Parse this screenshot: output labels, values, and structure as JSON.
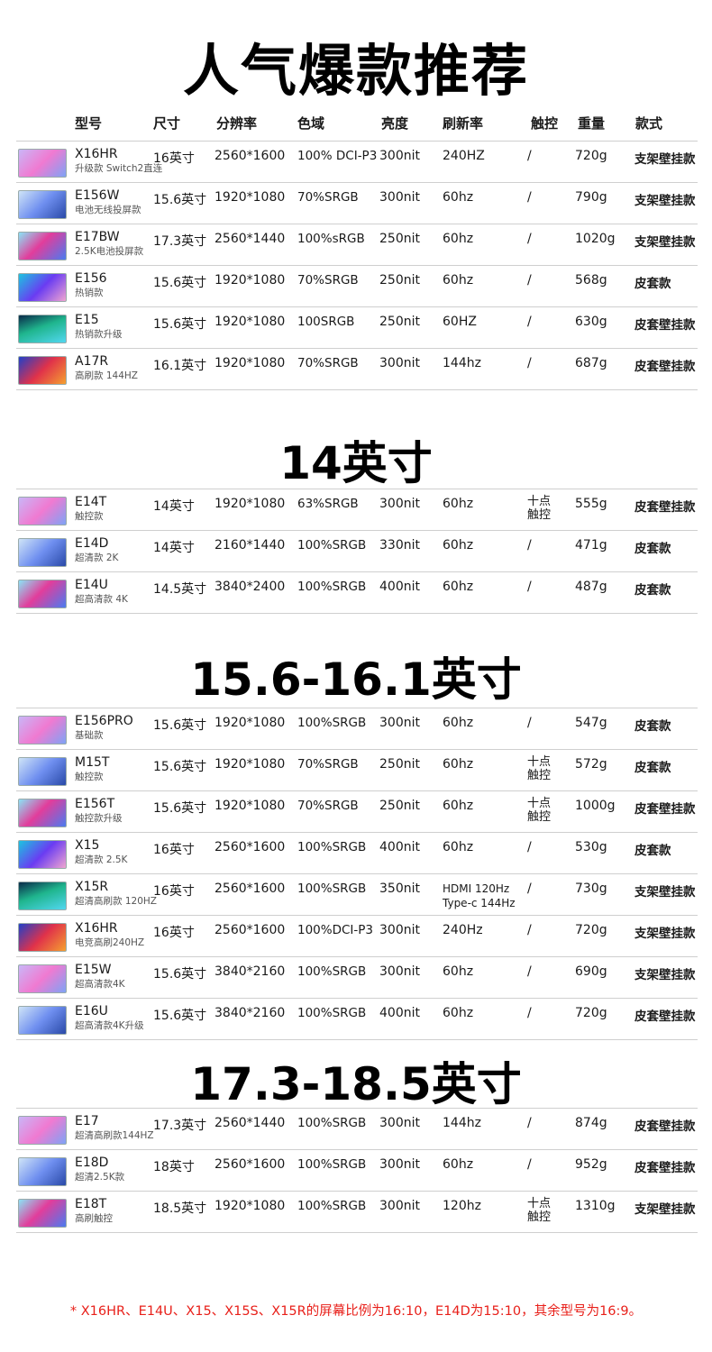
{
  "title_main": "人气爆款推荐",
  "headers": {
    "model": "型号",
    "size": "尺寸",
    "resolution": "分辨率",
    "gamut": "色域",
    "brightness": "亮度",
    "refresh": "刷新率",
    "touch": "触控",
    "weight": "重量",
    "style": "款式"
  },
  "section1": {
    "rows": [
      {
        "model": "X16HR",
        "sub": "升级款 Switch2直连",
        "size": "16英寸",
        "res": "2560*1600",
        "gamut": "100% DCI-P3",
        "bri": "300nit",
        "hz": "240HZ",
        "touch": "/",
        "wt": "720g",
        "style": "支架壁挂款"
      },
      {
        "model": "E156W",
        "sub": "电池无线投屏款",
        "size": "15.6英寸",
        "res": "1920*1080",
        "gamut": "70%SRGB",
        "bri": "300nit",
        "hz": "60hz",
        "touch": "/",
        "wt": "790g",
        "style": "支架壁挂款"
      },
      {
        "model": "E17BW",
        "sub": "2.5K电池投屏款",
        "size": "17.3英寸",
        "res": "2560*1440",
        "gamut": "100%sRGB",
        "bri": "250nit",
        "hz": "60hz",
        "touch": "/",
        "wt": "1020g",
        "style": "支架壁挂款"
      },
      {
        "model": "E156",
        "sub": "热销款",
        "size": "15.6英寸",
        "res": "1920*1080",
        "gamut": "70%SRGB",
        "bri": "250nit",
        "hz": "60hz",
        "touch": "/",
        "wt": "568g",
        "style": "皮套款"
      },
      {
        "model": "E15",
        "sub": "热销款升级",
        "size": "15.6英寸",
        "res": "1920*1080",
        "gamut": "100SRGB",
        "bri": "250nit",
        "hz": "60HZ",
        "touch": "/",
        "wt": "630g",
        "style": "皮套壁挂款"
      },
      {
        "model": "A17R",
        "sub": "高刷款 144HZ",
        "size": "16.1英寸",
        "res": "1920*1080",
        "gamut": "70%SRGB",
        "bri": "300nit",
        "hz": "144hz",
        "touch": "/",
        "wt": "687g",
        "style": "皮套壁挂款"
      }
    ]
  },
  "section2": {
    "title": "14英寸",
    "rows": [
      {
        "model": "E14T",
        "sub": "触控款",
        "size": "14英寸",
        "res": "1920*1080",
        "gamut": "63%SRGB",
        "bri": "300nit",
        "hz": "60hz",
        "touch1": "十点",
        "touch2": "触控",
        "wt": "555g",
        "style": "皮套壁挂款"
      },
      {
        "model": "E14D",
        "sub": "超清款 2K",
        "size": "14英寸",
        "res": "2160*1440",
        "gamut": "100%SRGB",
        "bri": "330nit",
        "hz": "60hz",
        "touch": "/",
        "wt": "471g",
        "style": "皮套款"
      },
      {
        "model": "E14U",
        "sub": "超高清款 4K",
        "size": "14.5英寸",
        "res": "3840*2400",
        "gamut": "100%SRGB",
        "bri": "400nit",
        "hz": "60hz",
        "touch": "/",
        "wt": "487g",
        "style": "皮套款"
      }
    ]
  },
  "section3": {
    "title": "15.6-16.1英寸",
    "rows": [
      {
        "model": "E156PRO",
        "sub": "基础款",
        "size": "15.6英寸",
        "res": "1920*1080",
        "gamut": "100%SRGB",
        "bri": "300nit",
        "hz": "60hz",
        "touch": "/",
        "wt": "547g",
        "style": "皮套款"
      },
      {
        "model": "M15T",
        "sub": "触控款",
        "size": "15.6英寸",
        "res": "1920*1080",
        "gamut": "70%SRGB",
        "bri": "250nit",
        "hz": "60hz",
        "touch1": "十点",
        "touch2": "触控",
        "wt": "572g",
        "style": "皮套款"
      },
      {
        "model": "E156T",
        "sub": "触控款升级",
        "size": "15.6英寸",
        "res": "1920*1080",
        "gamut": "70%SRGB",
        "bri": "250nit",
        "hz": "60hz",
        "touch1": "十点",
        "touch2": "触控",
        "wt": "1000g",
        "style": "皮套壁挂款"
      },
      {
        "model": "X15",
        "sub": "超清款 2.5K",
        "size": "16英寸",
        "res": "2560*1600",
        "gamut": "100%SRGB",
        "bri": "400nit",
        "hz": "60hz",
        "touch": "/",
        "wt": "530g",
        "style": "皮套款"
      },
      {
        "model": "X15R",
        "sub": "超清高刷款 120HZ",
        "size": "16英寸",
        "res": "2560*1600",
        "gamut": "100%SRGB",
        "bri": "350nit",
        "hz1": "HDMI 120Hz",
        "hz2": "Type-c 144Hz",
        "touch": "/",
        "wt": "730g",
        "style": "支架壁挂款"
      },
      {
        "model": "X16HR",
        "sub": "电竞高刷240HZ",
        "size": "16英寸",
        "res": "2560*1600",
        "gamut": "100%DCI-P3",
        "bri": "300nit",
        "hz": "240Hz",
        "touch": "/",
        "wt": "720g",
        "style": "支架壁挂款"
      },
      {
        "model": "E15W",
        "sub": "超高清款4K",
        "size": "15.6英寸",
        "res": "3840*2160",
        "gamut": "100%SRGB",
        "bri": "300nit",
        "hz": "60hz",
        "touch": "/",
        "wt": "690g",
        "style": "支架壁挂款"
      },
      {
        "model": "E16U",
        "sub": "超高清款4K升级",
        "size": "15.6英寸",
        "res": "3840*2160",
        "gamut": "100%SRGB",
        "bri": "400nit",
        "hz": "60hz",
        "touch": "/",
        "wt": "720g",
        "style": "皮套壁挂款"
      }
    ]
  },
  "section4": {
    "title": "17.3-18.5英寸",
    "rows": [
      {
        "model": "E17",
        "sub": "超清高刷款144HZ",
        "size": "17.3英寸",
        "res": "2560*1440",
        "gamut": "100%SRGB",
        "bri": "300nit",
        "hz": "144hz",
        "touch": "/",
        "wt": "874g",
        "style": "皮套壁挂款"
      },
      {
        "model": "E18D",
        "sub": "超清2.5K款",
        "size": "18英寸",
        "res": "2560*1600",
        "gamut": "100%SRGB",
        "bri": "300nit",
        "hz": "60hz",
        "touch": "/",
        "wt": "952g",
        "style": "皮套壁挂款"
      },
      {
        "model": "E18T",
        "sub": "高刷触控",
        "size": "18.5英寸",
        "res": "1920*1080",
        "gamut": "100%SRGB",
        "bri": "300nit",
        "hz": "120hz",
        "touch1": "十点",
        "touch2": "触控",
        "wt": "1310g",
        "style": "支架壁挂款"
      }
    ]
  },
  "footnote": "* X16HR、E14U、X15、X15S、X15R的屏幕比例为16:10，E14D为15:10，其余型号为16:9。",
  "colors": {
    "accent_red": "#e8201a",
    "rule": "#cfcfcf",
    "text": "#1a1a1a"
  }
}
